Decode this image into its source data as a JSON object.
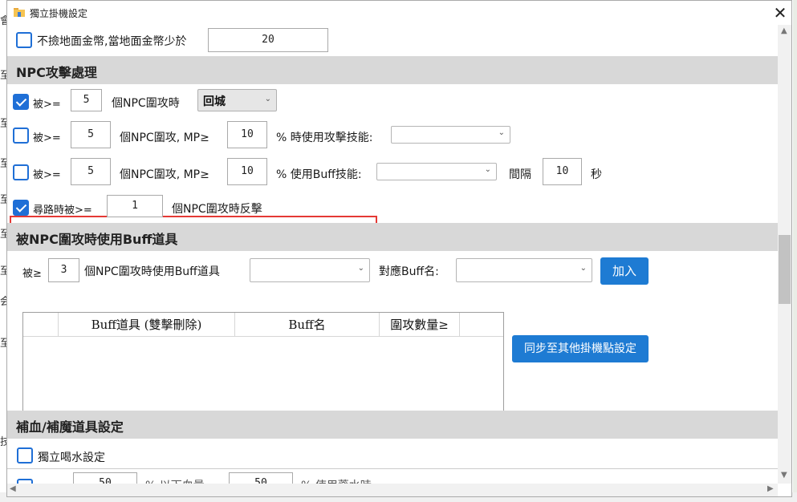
{
  "window": {
    "title": "獨立掛機設定",
    "close_glyph": "✕"
  },
  "background": {
    "left_glyphs": [
      "會",
      "至",
      "至",
      "至",
      "至",
      "至",
      "至",
      "至",
      "会",
      "技"
    ]
  },
  "coin": {
    "label": "不撿地面金幣,當地面金幣少於",
    "value": "20",
    "checked": false
  },
  "sections": {
    "npc_attack": "NPC攻擊處理",
    "buff_items": "被NPC圍攻時使用Buff道具",
    "heal_mana": "補血/補魔道具設定"
  },
  "row1": {
    "prefix": "被>=",
    "count": "5",
    "mid": "個NPC圍攻時",
    "select_value": "回城",
    "checked": true
  },
  "row2": {
    "prefix": "被>=",
    "count": "5",
    "mid": "個NPC圍攻, MP≥",
    "mp": "10",
    "suffix": "% 時使用攻擊技能:",
    "checked": false
  },
  "row3": {
    "prefix": "被>=",
    "count": "5",
    "mid": "個NPC圍攻, MP≥",
    "mp": "10",
    "suffix": "% 使用Buff技能:",
    "interval_label": "間隔",
    "interval": "10",
    "seconds": "秒",
    "checked": false
  },
  "row4": {
    "prefix": "尋路時被>=",
    "count": "1",
    "suffix": "個NPC圍攻時反擊",
    "checked": true
  },
  "buff": {
    "prefix": "被≥",
    "count": "3",
    "mid": "個NPC圍攻時使用Buff道具",
    "map_label": "對應Buff名:",
    "add_button": "加入",
    "sync_button": "同步至其他掛機點設定",
    "table_headers": [
      "Buff道具 (雙擊刪除)",
      "Buff名",
      "圍攻數量≥"
    ]
  },
  "heal": {
    "drink_label": "獨立喝水設定",
    "drink_checked": false,
    "partial_v1": "50",
    "partial_t1": "% 以下血量",
    "partial_v2": "50",
    "partial_t2": "% 使用藥水時"
  },
  "colors": {
    "accent": "#1f6fd6",
    "button": "#1e7bd3",
    "section_bg": "#d8d8d8",
    "highlight": "#e53935"
  },
  "icons": {
    "app": "folder-icon",
    "dropdown": "chevron-down-icon"
  }
}
